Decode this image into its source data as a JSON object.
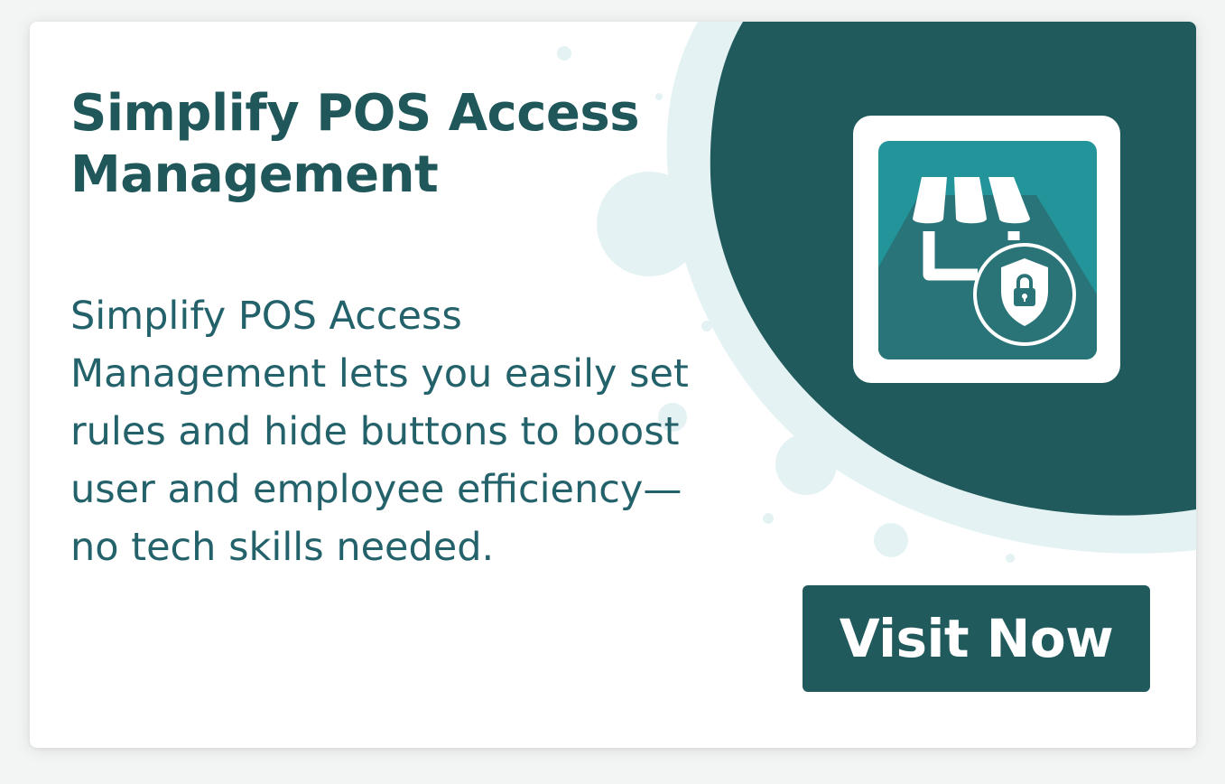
{
  "promo": {
    "title": "Simplify POS Access Management",
    "description": "Simplify POS Access Management lets you easily set rules and hide buttons to boost user and employee efficiency—no tech skills needed.",
    "cta_label": "Visit Now"
  },
  "icon": {
    "name": "store-lock-icon"
  },
  "colors": {
    "primary_dark_teal": "#215a5c",
    "title_teal": "#20575a",
    "icon_tile_teal": "#23959a",
    "bubble_light": "#e4f2f3",
    "background_white": "#ffffff"
  }
}
